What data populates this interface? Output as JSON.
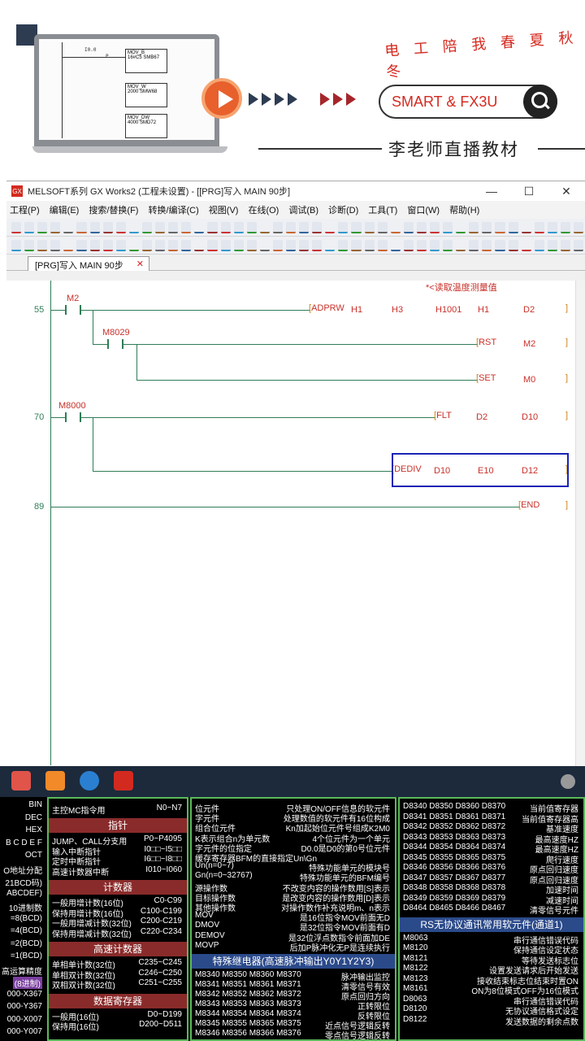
{
  "banner": {
    "slogan": "电 工 陪 我 春 夏 秋 冬",
    "search_text": "SMART & FX3U",
    "teacher": "李老师直播教材",
    "mini_ladder": {
      "contact": "I0.0",
      "p": "P",
      "blocks": [
        {
          "name": "MOV_B",
          "in": "16#C5",
          "out": "SMB67"
        },
        {
          "name": "MOV_W",
          "in": "2000",
          "out": "SMW68"
        },
        {
          "name": "MOV_DW",
          "in": "4000",
          "out": "SMD72"
        }
      ]
    }
  },
  "window": {
    "title": "MELSOFT系列 GX Works2 (工程未设置) - [[PRG]写入 MAIN 90步]",
    "app_icon": "GX",
    "buttons": [
      "—",
      "☐",
      "✕"
    ],
    "menus": [
      "工程(P)",
      "编辑(E)",
      "搜索/替换(F)",
      "转换/编译(C)",
      "视图(V)",
      "在线(O)",
      "调试(B)",
      "诊断(D)",
      "工具(T)",
      "窗口(W)",
      "帮助(H)"
    ],
    "tab_label": "[PRG]写入 MAIN 90步",
    "tab_close": "✕",
    "comment": "*<读取温度测量值"
  },
  "ladder": {
    "rung55": {
      "step": "55",
      "contact": "M2",
      "instr": "ADPRW",
      "ops": [
        "H1",
        "H3",
        "H1001",
        "H1",
        "D2"
      ],
      "branch_contact": "M8029",
      "rst": "RST",
      "rst_op": "M2",
      "set": "SET",
      "set_op": "M0"
    },
    "rung70": {
      "step": "70",
      "contact": "M8000",
      "instr1": "FLT",
      "ops1": [
        "D2",
        "D10"
      ],
      "instr2": "DEDIV",
      "ops2": [
        "D10",
        "E10",
        "D12"
      ]
    },
    "rung89": {
      "step": "89",
      "instr": "END"
    }
  },
  "reference": {
    "col1": {
      "labels": [
        "BIN",
        "DEC",
        "HEX",
        "B C D E F",
        "OCT",
        "O地址分配",
        "21BCD码)",
        "ABCDEF)",
        "10进制数",
        "=8(BCD)",
        "=4(BCD)",
        "=2(BCD)",
        "=1(BCD)",
        "高运算精度",
        "(8进制)",
        "000-X367",
        "000-Y367",
        "000-X007",
        "000-Y007"
      ]
    },
    "col2": {
      "top_row": [
        "主控MC指令用",
        "N0~N7"
      ],
      "pointer_title": "指针",
      "pointer_rows": [
        [
          "JUMP、CALL分支用",
          "P0~P4095"
        ],
        [
          "输入中断指针",
          "I0□□~I5□□"
        ],
        [
          "定时中断指针",
          "I6□□~I8□□"
        ],
        [
          "高速计数器中断",
          "I010~I060"
        ]
      ],
      "counter_title": "计数器",
      "counter_rows": [
        [
          "一般用增计数(16位)",
          "C0-C99"
        ],
        [
          "保持用增计数(16位)",
          "C100-C199"
        ],
        [
          "一般用增减计数(32位)",
          "C200-C219"
        ],
        [
          "保持用增减计数(32位)",
          "C220-C234"
        ]
      ],
      "hsc_title": "高速计数器",
      "hsc_rows": [
        [
          "单相单计数(32位)",
          "C235~C245"
        ],
        [
          "单相双计数(32位)",
          "C246~C250"
        ],
        [
          "双相双计数(32位)",
          "C251~C255"
        ]
      ],
      "data_title": "数据寄存器",
      "data_rows": [
        [
          "一般用(16位)",
          "D0~D199"
        ],
        [
          "保持用(16位)",
          "D200~D511"
        ]
      ]
    },
    "col3": {
      "rows": [
        [
          "位元件",
          "只处理ON/OFF信息的软元件"
        ],
        [
          "字元件",
          "处理数值的软元件有16位构成"
        ],
        [
          "组合位元件",
          "Kn加起始位元件号组成K2M0"
        ],
        [
          "K表示组合n为单元数",
          "4个位元件为一个单元"
        ],
        [
          "字元件的位指定",
          "D0.0是D0的第0号位元件"
        ],
        [
          "缓存寄存器BFM的直接指定Un\\Gn",
          ""
        ],
        [
          "Un(n=0~7)",
          "特殊功能单元的模块号"
        ],
        [
          "Gn(n=0~32767)",
          "特殊功能单元的BFM编号"
        ],
        [
          "源操作数",
          "不改变内容的操作数用[S]表示"
        ],
        [
          "目标操作数",
          "是改变内容的操作数用[D]表示"
        ],
        [
          "其他操作数",
          "对操作数作补充说明m、n表示"
        ],
        [
          "MOV",
          "是16位指令MOV前面无D"
        ],
        [
          "DMOV",
          "是32位指令MOV前面有D"
        ],
        [
          "DEMOV",
          "是32位浮点数指令前面加DE"
        ],
        [
          "MOVP",
          "后加P脉冲化无P是连续执行"
        ]
      ],
      "relay_title": "特殊继电器(高速脉冲输出Y0Y1Y2Y3)",
      "relay_rows": [
        [
          "M8340 M8350 M8360 M8370",
          "脉冲输出监控"
        ],
        [
          "M8341 M8351 M8361 M8371",
          "清零信号有效"
        ],
        [
          "M8342 M8352 M8362 M8372",
          "原点回归方向"
        ],
        [
          "M8343 M8353 M8363 M8373",
          "正转限位"
        ],
        [
          "M8344 M8354 M8364 M8374",
          "反转限位"
        ],
        [
          "M8345 M8355 M8365 M8375",
          "近点信号逻辑反转"
        ],
        [
          "M8346 M8356 M8366 M8376",
          "零点信号逻辑反转"
        ]
      ]
    },
    "col4": {
      "rows": [
        [
          "D8340 D8350 D8360 D8370",
          "当前值寄存器"
        ],
        [
          "D8341 D8351 D8361 D8371",
          "当前值寄存器高"
        ],
        [
          "D8342 D8352 D8362 D8372",
          "基准速度"
        ],
        [
          "D8343 D8353 D8363 D8373",
          "最高速度HZ"
        ],
        [
          "D8344 D8354 D8364 D8374",
          "最高速度HZ"
        ],
        [
          "D8345 D8355 D8365 D8375",
          "爬行速度"
        ],
        [
          "D8346 D8356 D8366 D8376",
          "原点回归速度"
        ],
        [
          "D8347 D8357 D8367 D8377",
          "原点回归速度"
        ],
        [
          "D8348 D8358 D8368 D8378",
          "加速时间"
        ],
        [
          "D8349 D8359 D8369 D8379",
          "减速时间"
        ],
        [
          "D8464 D8465 D8466 D8467",
          "清零信号元件"
        ]
      ],
      "rs_title": "RS无协议通讯常用软元件(通道1)",
      "rs_rows": [
        [
          "M8063",
          "串行通信错误代码"
        ],
        [
          "M8120",
          "保持通信设定状态"
        ],
        [
          "M8121",
          "等待发送标志位"
        ],
        [
          "M8122",
          "设置发送请求后开始发送"
        ],
        [
          "M8123",
          "接收结束标志位结束时置ON"
        ],
        [
          "M8161",
          "ON为8位模式OFF为16位模式"
        ],
        [
          "D8063",
          "串行通信错误代码"
        ],
        [
          "D8120",
          "无协议通信格式设定"
        ],
        [
          "D8122",
          "发送数据的剩余点数"
        ]
      ]
    }
  }
}
